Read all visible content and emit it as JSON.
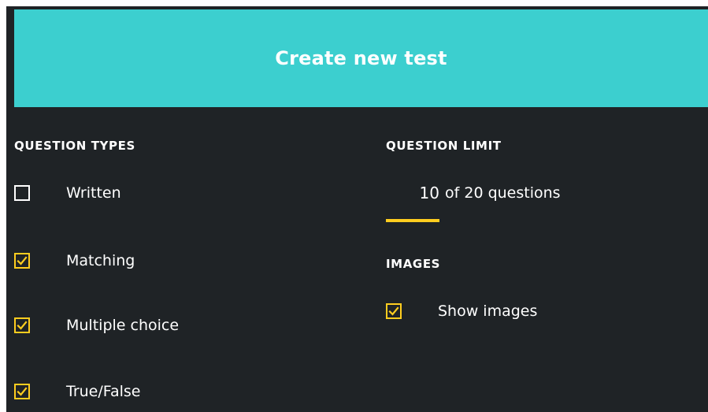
{
  "header": {
    "create_button_label": "Create new test"
  },
  "question_types": {
    "heading": "QUESTION TYPES",
    "items": [
      {
        "label": "Written",
        "checked": false
      },
      {
        "label": "Matching",
        "checked": true
      },
      {
        "label": "Multiple choice",
        "checked": true
      },
      {
        "label": "True/False",
        "checked": true
      }
    ]
  },
  "question_limit": {
    "heading": "QUESTION LIMIT",
    "value": "10",
    "suffix": "of 20 questions"
  },
  "images": {
    "heading": "IMAGES",
    "show_images_label": "Show images",
    "show_images_checked": true
  },
  "colors": {
    "panel_background": "#1f2326",
    "header_background": "#3ccfcf",
    "accent": "#ffcd1f",
    "text": "#ffffff"
  }
}
